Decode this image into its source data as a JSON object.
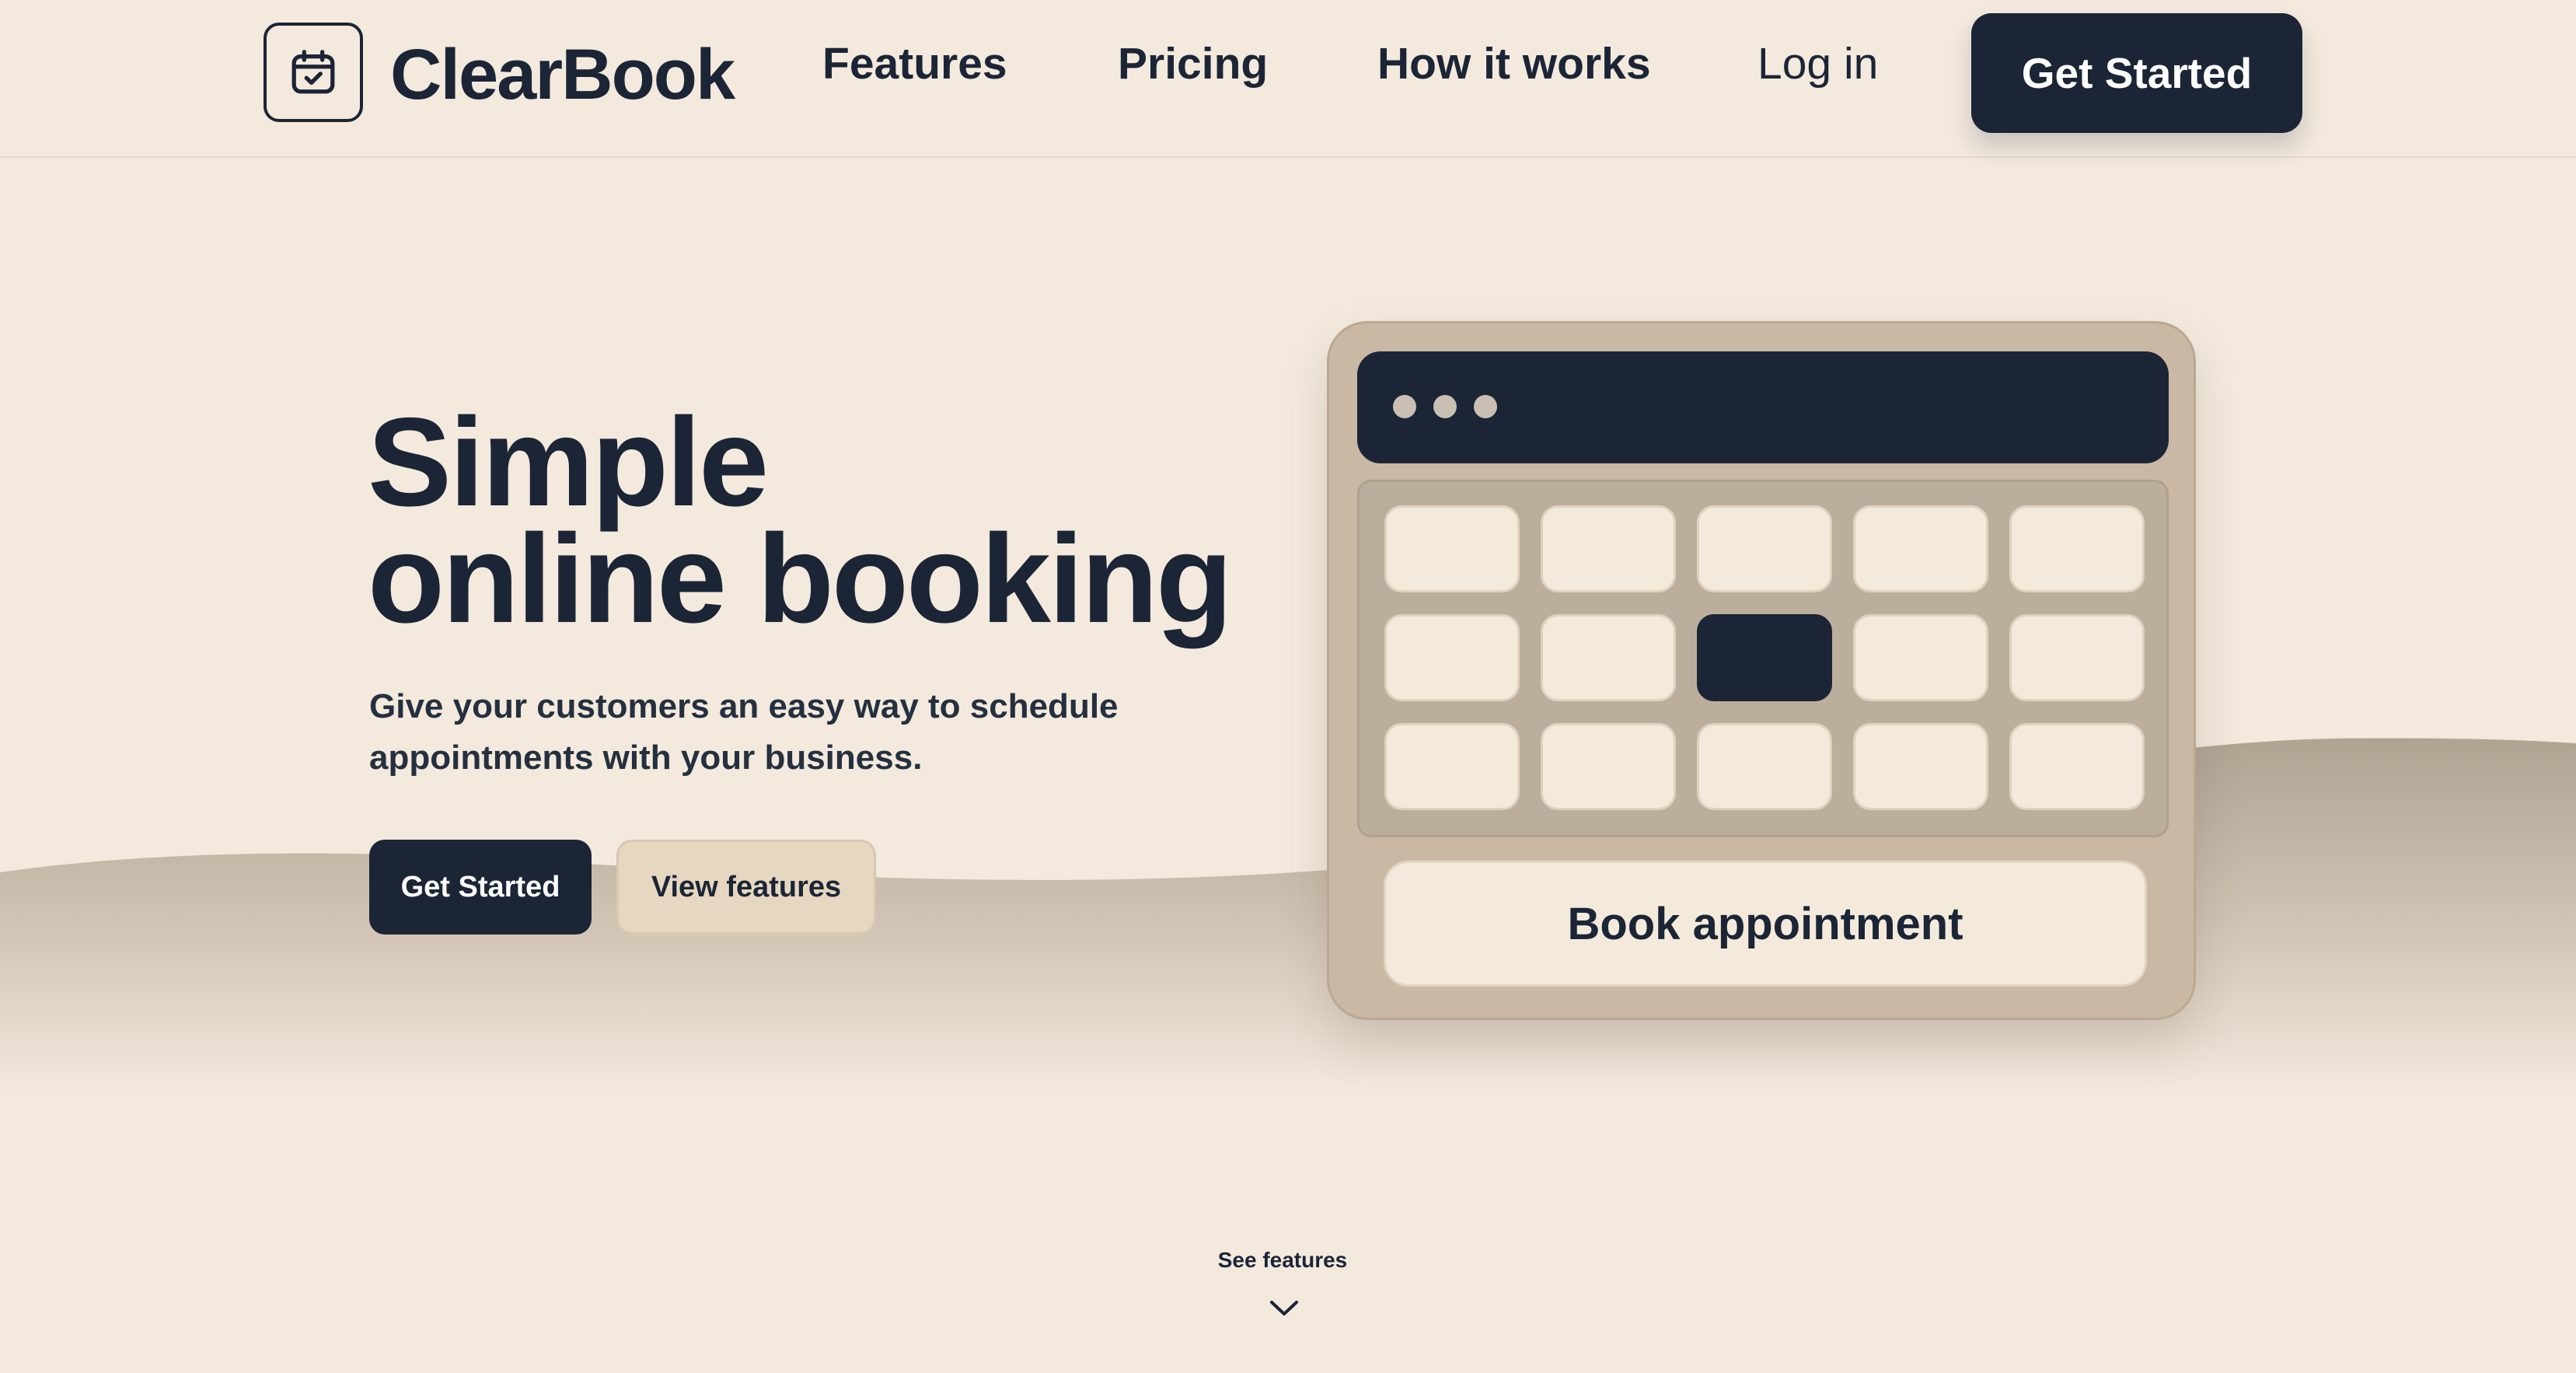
{
  "header": {
    "brand": "ClearBook",
    "logo_icon": "calendar-check-icon",
    "nav": [
      {
        "label": "Features"
      },
      {
        "label": "Pricing"
      },
      {
        "label": "How it works"
      }
    ],
    "login_label": "Log in",
    "cta_label": "Get Started"
  },
  "hero": {
    "title_line1": "Simple",
    "title_line2": "online booking",
    "subtitle": "Give your customers an easy way to schedule appointments with your business.",
    "primary_label": "Get Started",
    "secondary_label": "View features"
  },
  "widget": {
    "window_dots": 3,
    "grid_rows": 3,
    "grid_cols": 5,
    "selected_slot": {
      "row": 2,
      "col": 3
    },
    "book_label": "Book appointment"
  },
  "footer_hint": {
    "label": "See features",
    "icon": "chevron-down-icon"
  },
  "colors": {
    "background": "#f3e9dd",
    "primary": "#1b2536",
    "wave": "#b3a797",
    "widget": "#c8b8a4",
    "slot": "#f4eadb"
  }
}
